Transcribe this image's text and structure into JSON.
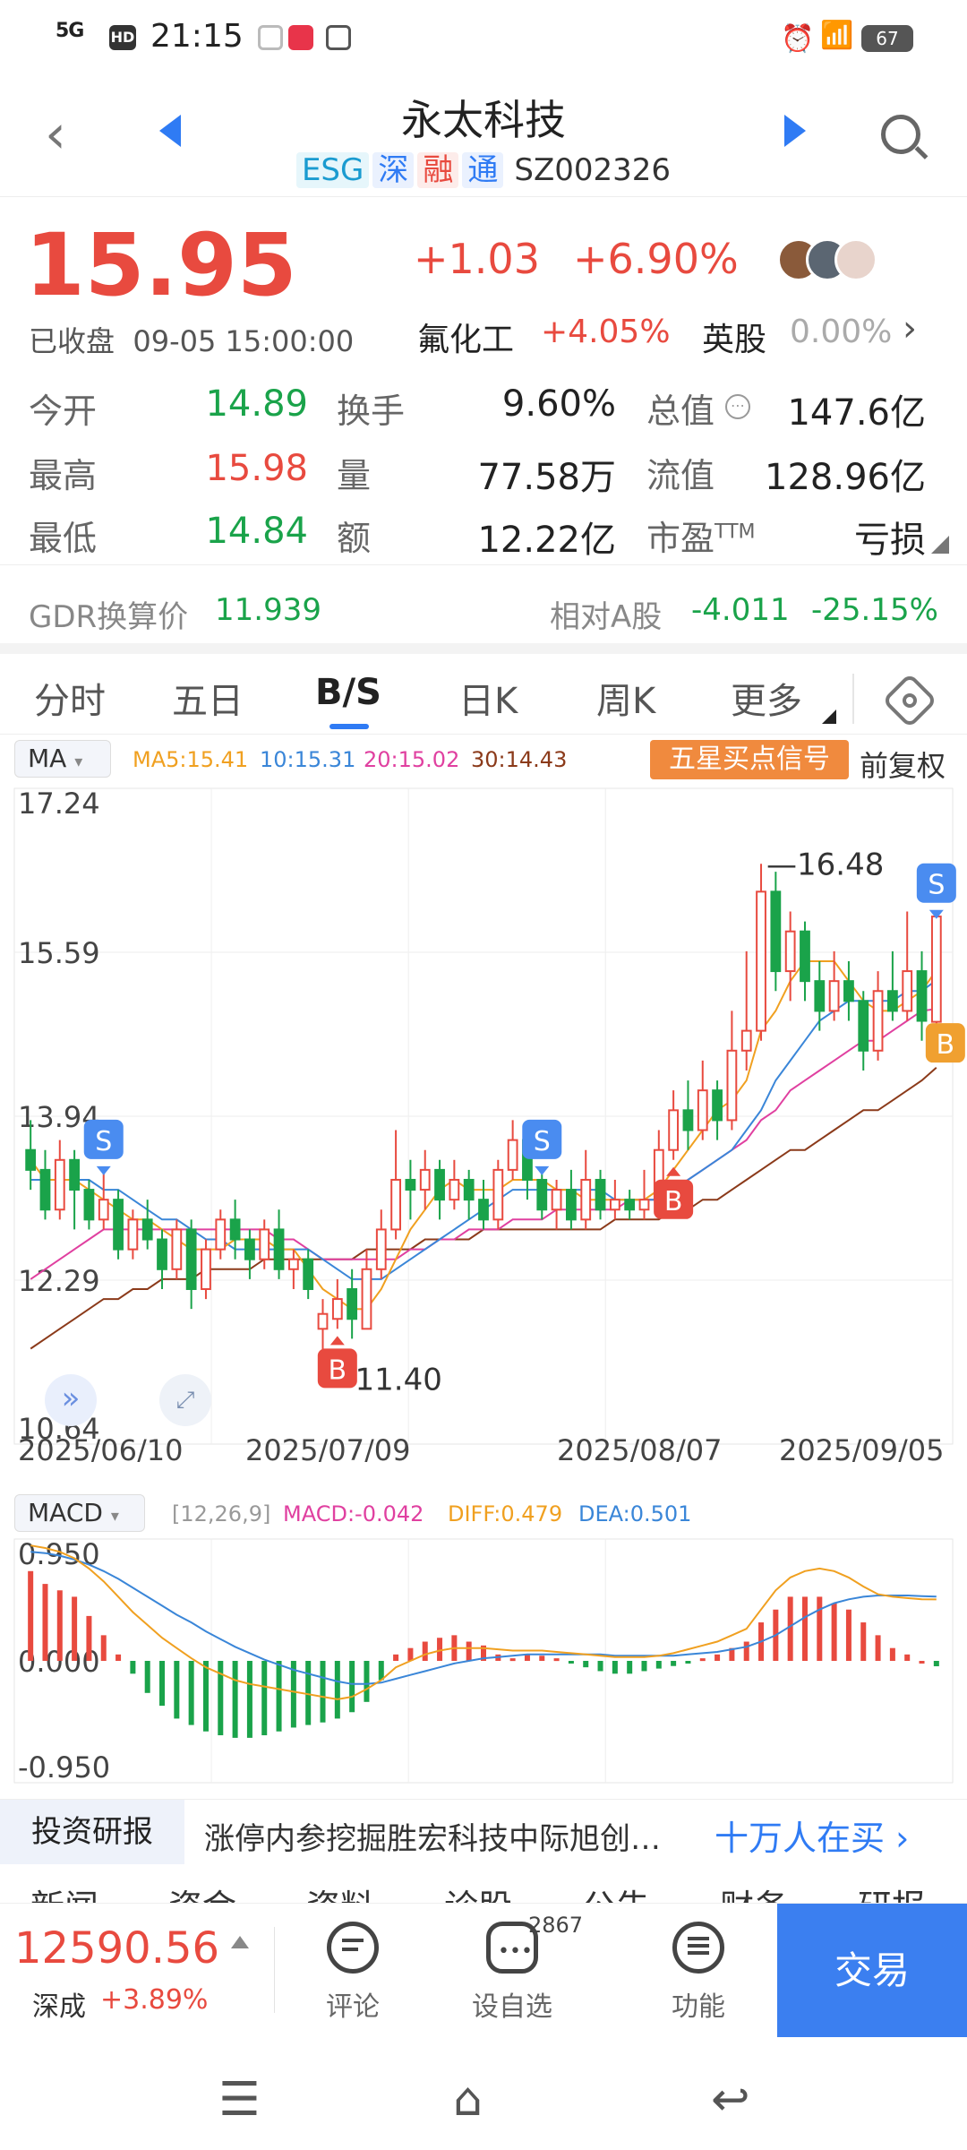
{
  "status_bar": {
    "signal": "5G",
    "hd": "HD",
    "time": "21:15",
    "battery": "67"
  },
  "header": {
    "title": "永太科技",
    "tags": [
      "ESG",
      "深",
      "融",
      "通"
    ],
    "code": "SZ002326"
  },
  "quote": {
    "price": "15.95",
    "change": "+1.03",
    "change_pct": "+6.90%",
    "status": "已收盘",
    "datetime": "09-05  15:00:00",
    "sector1_name": "氟化工",
    "sector1_change": "+4.05%",
    "sector2_name": "英股",
    "sector2_change": "0.00%"
  },
  "stats": [
    {
      "label": "今开",
      "value": "14.89",
      "color": "green"
    },
    {
      "label": "换手",
      "value": "9.60%",
      "color": "black"
    },
    {
      "label": "总值",
      "value": "147.6亿",
      "color": "black"
    },
    {
      "label": "最高",
      "value": "15.98",
      "color": "red"
    },
    {
      "label": "量",
      "value": "77.58万",
      "color": "black"
    },
    {
      "label": "流值",
      "value": "128.96亿",
      "color": "black"
    },
    {
      "label": "最低",
      "value": "14.84",
      "color": "green"
    },
    {
      "label": "额",
      "value": "12.22亿",
      "color": "black"
    },
    {
      "label": "市盈",
      "value": "亏损",
      "color": "black"
    }
  ],
  "stats_pe_sup": "TTM",
  "gdr": {
    "label": "GDR换算价",
    "value": "11.939",
    "rel_label": "相对A股",
    "rel_value": "-4.011",
    "rel_pct": "-25.15%"
  },
  "tabs": [
    "分时",
    "五日",
    "B/S",
    "日K",
    "周K",
    "更多"
  ],
  "active_tab": "B/S",
  "ma_legend": {
    "select": "MA",
    "ma5": "MA5:15.41",
    "ma10": "10:15.31",
    "ma20": "20:15.02",
    "ma30": "30:14.43",
    "colors": {
      "ma5": "#f0a020",
      "ma10": "#3a86d8",
      "ma20": "#e040a0",
      "ma30": "#8b3a1a"
    }
  },
  "signal_button": "五星买点信号",
  "fuquan": "前复权",
  "chart_data": [
    {
      "type": "candlestick",
      "y_ticks": [
        "17.24",
        "15.59",
        "13.94",
        "12.29",
        "10.64"
      ],
      "ylim": [
        10.64,
        17.24
      ],
      "x_labels": [
        "2025/06/10",
        "2025/07/09",
        "2025/08/07",
        "2025/09/05"
      ],
      "annotations": {
        "high": "16.48",
        "low": "11.40"
      },
      "markers": [
        {
          "label": "S",
          "index": 5
        },
        {
          "label": "B",
          "index": 21
        },
        {
          "label": "S",
          "index": 35
        },
        {
          "label": "B",
          "index": 44
        },
        {
          "label": "S",
          "index": 62
        },
        {
          "label": "B",
          "index": 62
        }
      ],
      "candles": [
        [
          13.6,
          13.4,
          13.9,
          13.2
        ],
        [
          13.4,
          13.0,
          13.6,
          12.9
        ],
        [
          13.0,
          13.5,
          13.7,
          12.9
        ],
        [
          13.5,
          13.2,
          13.6,
          12.8
        ],
        [
          13.2,
          12.9,
          13.3,
          12.8
        ],
        [
          12.9,
          13.1,
          13.4,
          12.8
        ],
        [
          13.1,
          12.6,
          13.2,
          12.5
        ],
        [
          12.6,
          12.9,
          13.0,
          12.5
        ],
        [
          12.9,
          12.7,
          13.1,
          12.6
        ],
        [
          12.7,
          12.4,
          12.8,
          12.2
        ],
        [
          12.4,
          12.8,
          12.9,
          12.3
        ],
        [
          12.8,
          12.2,
          12.9,
          12.0
        ],
        [
          12.2,
          12.6,
          12.7,
          12.1
        ],
        [
          12.6,
          12.9,
          13.0,
          12.5
        ],
        [
          12.9,
          12.7,
          13.1,
          12.5
        ],
        [
          12.7,
          12.5,
          12.8,
          12.3
        ],
        [
          12.5,
          12.8,
          12.9,
          12.4
        ],
        [
          12.8,
          12.4,
          13.0,
          12.3
        ],
        [
          12.4,
          12.5,
          12.6,
          12.2
        ],
        [
          12.5,
          12.2,
          12.6,
          12.1
        ],
        [
          11.8,
          11.95,
          12.1,
          11.4
        ],
        [
          11.9,
          12.1,
          12.3,
          11.8
        ],
        [
          12.2,
          11.9,
          12.4,
          11.7
        ],
        [
          11.8,
          12.4,
          12.6,
          11.8
        ],
        [
          12.4,
          12.8,
          13.0,
          12.3
        ],
        [
          12.8,
          13.3,
          13.8,
          12.7
        ],
        [
          13.3,
          13.2,
          13.5,
          12.9
        ],
        [
          13.2,
          13.4,
          13.6,
          13.0
        ],
        [
          13.4,
          13.1,
          13.5,
          12.9
        ],
        [
          13.1,
          13.3,
          13.5,
          13.0
        ],
        [
          13.3,
          13.1,
          13.4,
          12.9
        ],
        [
          13.1,
          12.9,
          13.3,
          12.8
        ],
        [
          12.9,
          13.4,
          13.5,
          12.8
        ],
        [
          13.4,
          13.7,
          13.9,
          13.3
        ],
        [
          13.7,
          13.3,
          13.8,
          13.1
        ],
        [
          13.3,
          13.0,
          13.4,
          12.9
        ],
        [
          13.0,
          13.2,
          13.3,
          12.8
        ],
        [
          13.2,
          12.9,
          13.4,
          12.8
        ],
        [
          12.9,
          13.3,
          13.6,
          12.8
        ],
        [
          13.3,
          13.0,
          13.4,
          12.9
        ],
        [
          13.0,
          13.1,
          13.3,
          12.9
        ],
        [
          13.1,
          13.0,
          13.2,
          12.9
        ],
        [
          13.0,
          13.1,
          13.4,
          12.9
        ],
        [
          13.1,
          13.6,
          13.8,
          13.0
        ],
        [
          13.6,
          14.0,
          14.2,
          13.5
        ],
        [
          14.0,
          13.8,
          14.3,
          13.6
        ],
        [
          13.8,
          14.2,
          14.5,
          13.7
        ],
        [
          14.2,
          13.9,
          14.3,
          13.7
        ],
        [
          13.9,
          14.6,
          15.0,
          13.8
        ],
        [
          14.6,
          14.8,
          15.6,
          14.4
        ],
        [
          14.8,
          16.2,
          16.48,
          14.7
        ],
        [
          16.2,
          15.4,
          16.4,
          15.2
        ],
        [
          15.4,
          15.8,
          16.0,
          15.1
        ],
        [
          15.8,
          15.3,
          15.9,
          15.1
        ],
        [
          15.3,
          15.0,
          15.5,
          14.8
        ],
        [
          15.0,
          15.3,
          15.6,
          14.9
        ],
        [
          15.3,
          15.1,
          15.5,
          14.9
        ],
        [
          15.1,
          14.6,
          15.2,
          14.4
        ],
        [
          14.6,
          15.2,
          15.4,
          14.5
        ],
        [
          15.2,
          15.0,
          15.6,
          14.9
        ],
        [
          15.0,
          15.4,
          16.0,
          14.9
        ],
        [
          15.4,
          14.9,
          15.6,
          14.7
        ],
        [
          14.89,
          15.95,
          15.98,
          14.84
        ]
      ],
      "ma5": [
        13.5,
        13.3,
        13.3,
        13.3,
        13.2,
        13.1,
        13.0,
        12.9,
        12.9,
        12.8,
        12.7,
        12.6,
        12.6,
        12.6,
        12.7,
        12.7,
        12.7,
        12.6,
        12.6,
        12.4,
        12.2,
        12.1,
        12.0,
        12.0,
        12.2,
        12.5,
        12.8,
        13.0,
        13.2,
        13.3,
        13.2,
        13.2,
        13.2,
        13.3,
        13.3,
        13.3,
        13.2,
        13.2,
        13.1,
        13.1,
        13.1,
        13.1,
        13.1,
        13.2,
        13.4,
        13.6,
        13.8,
        14.0,
        14.1,
        14.3,
        14.8,
        15.0,
        15.3,
        15.5,
        15.5,
        15.5,
        15.3,
        15.1,
        15.0,
        15.0,
        15.1,
        15.2,
        15.41
      ],
      "ma10": [
        13.3,
        13.3,
        13.3,
        13.3,
        13.3,
        13.2,
        13.2,
        13.1,
        13.0,
        12.9,
        12.9,
        12.8,
        12.7,
        12.7,
        12.6,
        12.6,
        12.6,
        12.6,
        12.6,
        12.6,
        12.5,
        12.4,
        12.3,
        12.3,
        12.3,
        12.4,
        12.5,
        12.6,
        12.7,
        12.8,
        12.9,
        13.0,
        13.1,
        13.2,
        13.2,
        13.2,
        13.2,
        13.2,
        13.2,
        13.2,
        13.1,
        13.1,
        13.1,
        13.1,
        13.2,
        13.3,
        13.4,
        13.5,
        13.6,
        13.8,
        14.0,
        14.3,
        14.5,
        14.7,
        14.9,
        15.0,
        15.1,
        15.1,
        15.1,
        15.1,
        15.2,
        15.2,
        15.31
      ],
      "ma20": [
        12.3,
        12.4,
        12.5,
        12.6,
        12.7,
        12.8,
        12.8,
        12.8,
        12.8,
        12.8,
        12.8,
        12.8,
        12.8,
        12.8,
        12.8,
        12.8,
        12.8,
        12.7,
        12.7,
        12.6,
        12.5,
        12.5,
        12.5,
        12.5,
        12.5,
        12.5,
        12.6,
        12.6,
        12.7,
        12.7,
        12.8,
        12.8,
        12.8,
        12.9,
        12.9,
        12.9,
        13.0,
        13.0,
        13.0,
        13.0,
        13.0,
        13.1,
        13.1,
        13.1,
        13.2,
        13.3,
        13.4,
        13.5,
        13.6,
        13.7,
        13.9,
        14.0,
        14.2,
        14.3,
        14.4,
        14.5,
        14.6,
        14.7,
        14.7,
        14.8,
        14.9,
        15.0,
        15.02
      ],
      "ma30": [
        11.6,
        11.7,
        11.8,
        11.9,
        12.0,
        12.1,
        12.1,
        12.2,
        12.2,
        12.3,
        12.3,
        12.3,
        12.4,
        12.4,
        12.4,
        12.4,
        12.5,
        12.5,
        12.5,
        12.5,
        12.5,
        12.5,
        12.5,
        12.6,
        12.6,
        12.6,
        12.6,
        12.7,
        12.7,
        12.7,
        12.7,
        12.8,
        12.8,
        12.8,
        12.8,
        12.8,
        12.8,
        12.8,
        12.8,
        12.8,
        12.9,
        12.9,
        12.9,
        12.9,
        13.0,
        13.0,
        13.1,
        13.1,
        13.2,
        13.3,
        13.4,
        13.5,
        13.6,
        13.6,
        13.7,
        13.8,
        13.9,
        14.0,
        14.0,
        14.1,
        14.2,
        14.3,
        14.43
      ]
    },
    {
      "type": "bar",
      "indicator": "MACD",
      "params": "[12,26,9]",
      "macd_label": "MACD:-0.042",
      "diff_label": "DIFF:0.479",
      "dea_label": "DEA:0.501",
      "y_ticks": [
        "0.950",
        "0.000",
        "-0.950"
      ],
      "ylim": [
        -0.95,
        0.95
      ],
      "macd": [
        0.7,
        0.6,
        0.55,
        0.5,
        0.35,
        0.2,
        0.05,
        -0.1,
        -0.25,
        -0.35,
        -0.45,
        -0.5,
        -0.55,
        -0.58,
        -0.6,
        -0.6,
        -0.58,
        -0.55,
        -0.52,
        -0.5,
        -0.48,
        -0.45,
        -0.4,
        -0.32,
        -0.15,
        0.05,
        0.1,
        0.15,
        0.18,
        0.2,
        0.15,
        0.12,
        0.05,
        0.02,
        0.05,
        0.04,
        0.02,
        -0.02,
        -0.05,
        -0.08,
        -0.1,
        -0.1,
        -0.08,
        -0.06,
        -0.04,
        -0.02,
        0.02,
        0.05,
        0.1,
        0.15,
        0.3,
        0.4,
        0.5,
        0.5,
        0.5,
        0.45,
        0.4,
        0.3,
        0.2,
        0.1,
        0.05,
        0.0,
        -0.042
      ],
      "diff": [
        0.9,
        0.88,
        0.85,
        0.8,
        0.72,
        0.62,
        0.5,
        0.38,
        0.28,
        0.18,
        0.1,
        0.02,
        -0.05,
        -0.1,
        -0.15,
        -0.18,
        -0.2,
        -0.22,
        -0.24,
        -0.26,
        -0.28,
        -0.3,
        -0.28,
        -0.22,
        -0.15,
        -0.05,
        0.0,
        0.05,
        0.08,
        0.1,
        0.1,
        0.1,
        0.09,
        0.08,
        0.08,
        0.08,
        0.07,
        0.06,
        0.05,
        0.04,
        0.03,
        0.03,
        0.03,
        0.04,
        0.06,
        0.09,
        0.12,
        0.15,
        0.2,
        0.25,
        0.4,
        0.55,
        0.65,
        0.7,
        0.72,
        0.7,
        0.65,
        0.58,
        0.52,
        0.5,
        0.49,
        0.48,
        0.479
      ],
      "dea": [
        0.85,
        0.84,
        0.82,
        0.79,
        0.75,
        0.7,
        0.64,
        0.57,
        0.5,
        0.43,
        0.36,
        0.3,
        0.23,
        0.17,
        0.11,
        0.06,
        0.01,
        -0.03,
        -0.07,
        -0.1,
        -0.13,
        -0.16,
        -0.18,
        -0.18,
        -0.17,
        -0.14,
        -0.11,
        -0.08,
        -0.05,
        -0.02,
        0.0,
        0.02,
        0.03,
        0.04,
        0.05,
        0.05,
        0.05,
        0.05,
        0.05,
        0.05,
        0.04,
        0.04,
        0.04,
        0.04,
        0.04,
        0.05,
        0.06,
        0.07,
        0.09,
        0.11,
        0.15,
        0.2,
        0.27,
        0.34,
        0.4,
        0.45,
        0.48,
        0.5,
        0.51,
        0.51,
        0.51,
        0.505,
        0.501
      ]
    }
  ],
  "research": {
    "label": "投资研报",
    "text": "涨停内参挖掘胜宏科技中际旭创…",
    "buy": "十万人在买"
  },
  "news_tabs": [
    "新闻",
    "资金",
    "资料",
    "诊股",
    "公告",
    "财务",
    "研报"
  ],
  "bottom_bar": {
    "index_value": "12590.56",
    "index_name": "深成",
    "index_change": "+3.89%",
    "comment": "评论",
    "watchlist": "设自选",
    "watch_badge": "2867",
    "function": "功能",
    "trade": "交易"
  }
}
